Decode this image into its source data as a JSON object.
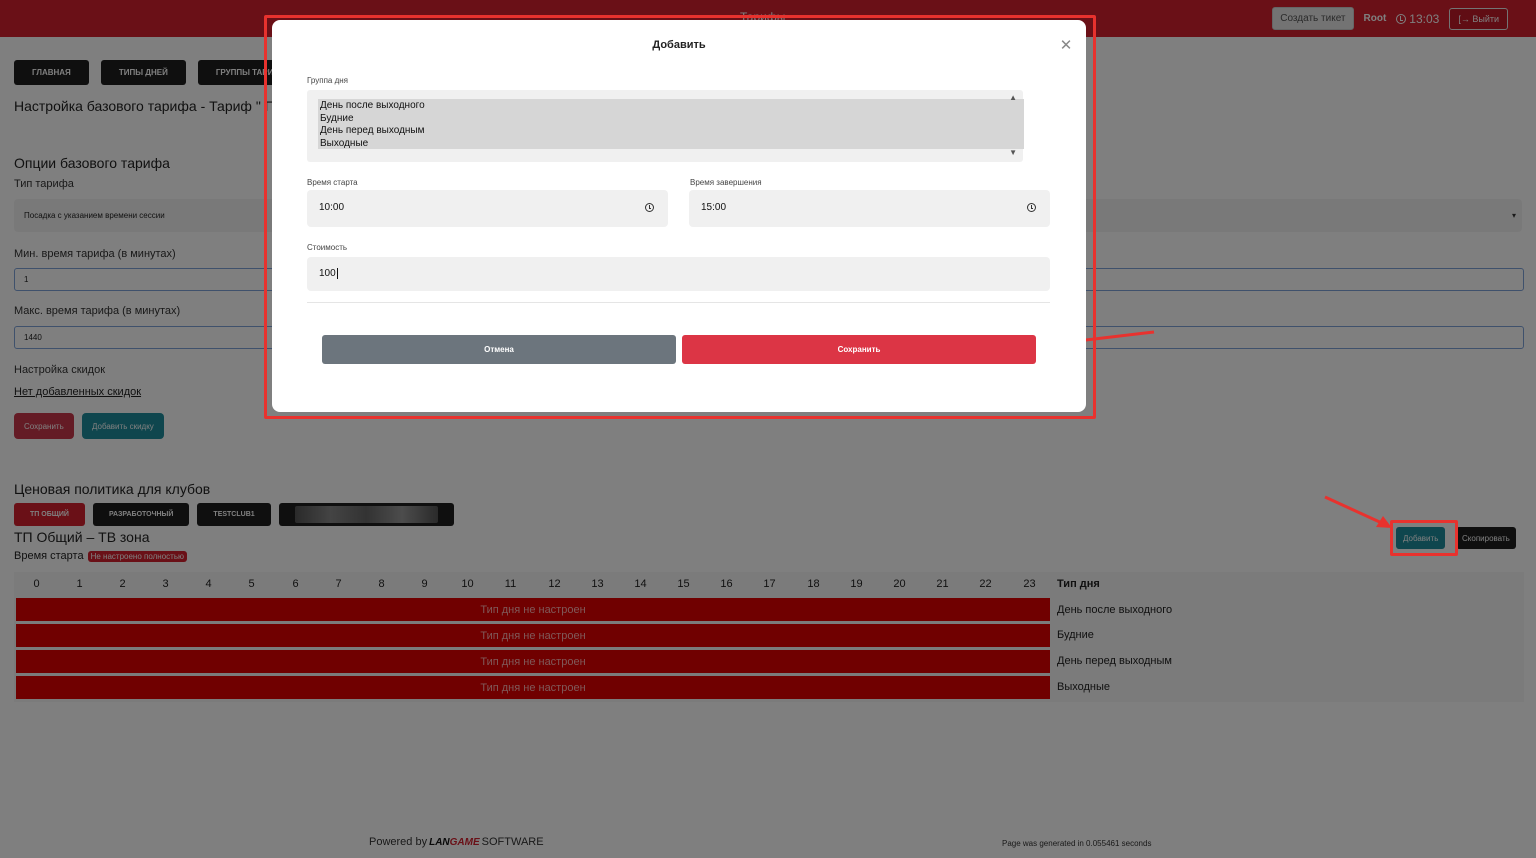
{
  "topbar": {
    "title": "Тарифы",
    "ticket_button": "Создать тикет",
    "user": "Root",
    "time": "13:03",
    "logout": "Выйти"
  },
  "nav": {
    "items": [
      {
        "label": "ГЛАВНАЯ"
      },
      {
        "label": "ТИПЫ ДНЕЙ"
      },
      {
        "label": "ГРУППЫ ТАРИФОВ"
      }
    ]
  },
  "page": {
    "heading": "Настройка базового тарифа - Тариф \" Г",
    "options_title": "Опции базового тарифа",
    "tariff_type_label": "Тип тарифа",
    "tariff_type_value": "Посадка с указанием времени сессии",
    "min_label": "Мин. время тарифа (в минутах)",
    "min_value": "1",
    "max_label": "Макс. время тарифа (в минутах)",
    "max_value": "1440",
    "discounts_label": "Настройка скидок",
    "no_discounts_link": "Нет добавленных скидок",
    "save_button": "Сохранить",
    "add_discount_button": "Добавить скидку"
  },
  "pricing": {
    "title": "Ценовая политика для клубов",
    "clubs": [
      {
        "label": "ТП ОБЩИЙ",
        "active": true
      },
      {
        "label": "РАЗРАБОТОЧНЫЙ",
        "active": false
      },
      {
        "label": "TESTCLUB1",
        "active": false
      }
    ],
    "zone_title": "ТП Общий – ТВ зона",
    "start_label": "Время старта",
    "start_badge": "Не настроено полностью",
    "add_button": "Добавить",
    "copy_button": "Скопировать"
  },
  "schedule": {
    "hours": [
      "0",
      "1",
      "2",
      "3",
      "4",
      "5",
      "6",
      "7",
      "8",
      "9",
      "10",
      "11",
      "12",
      "13",
      "14",
      "15",
      "16",
      "17",
      "18",
      "19",
      "20",
      "21",
      "22",
      "23"
    ],
    "day_type_header": "Тип дня",
    "rows": [
      {
        "status": "Тип дня не настроен",
        "day": "День после выходного"
      },
      {
        "status": "Тип дня не настроен",
        "day": "Будние"
      },
      {
        "status": "Тип дня не настроен",
        "day": "День перед выходным"
      },
      {
        "status": "Тип дня не настроен",
        "day": "Выходные"
      }
    ]
  },
  "footer": {
    "powered_by": "Powered by",
    "brand_a": "LAN",
    "brand_b": "GAME",
    "brand_c": "SOFTWARE",
    "generated": "Page was generated in 0.055461 seconds"
  },
  "modal": {
    "title": "Добавить",
    "day_group_label": "Группа дня",
    "day_group_options": [
      "День после выходного",
      "Будние",
      "День перед выходным",
      "Выходные"
    ],
    "start_time_label": "Время старта",
    "start_time_value": "10:00",
    "end_time_label": "Время завершения",
    "end_time_value": "15:00",
    "cost_label": "Стоимость",
    "cost_value": "100",
    "cancel_button": "Отмена",
    "save_button": "Сохранить"
  },
  "colors": {
    "brand_red": "#d4202e",
    "teal": "#1e8d9c",
    "annotation_red": "#e8322e",
    "unconfigured_bar": "#e00000"
  }
}
